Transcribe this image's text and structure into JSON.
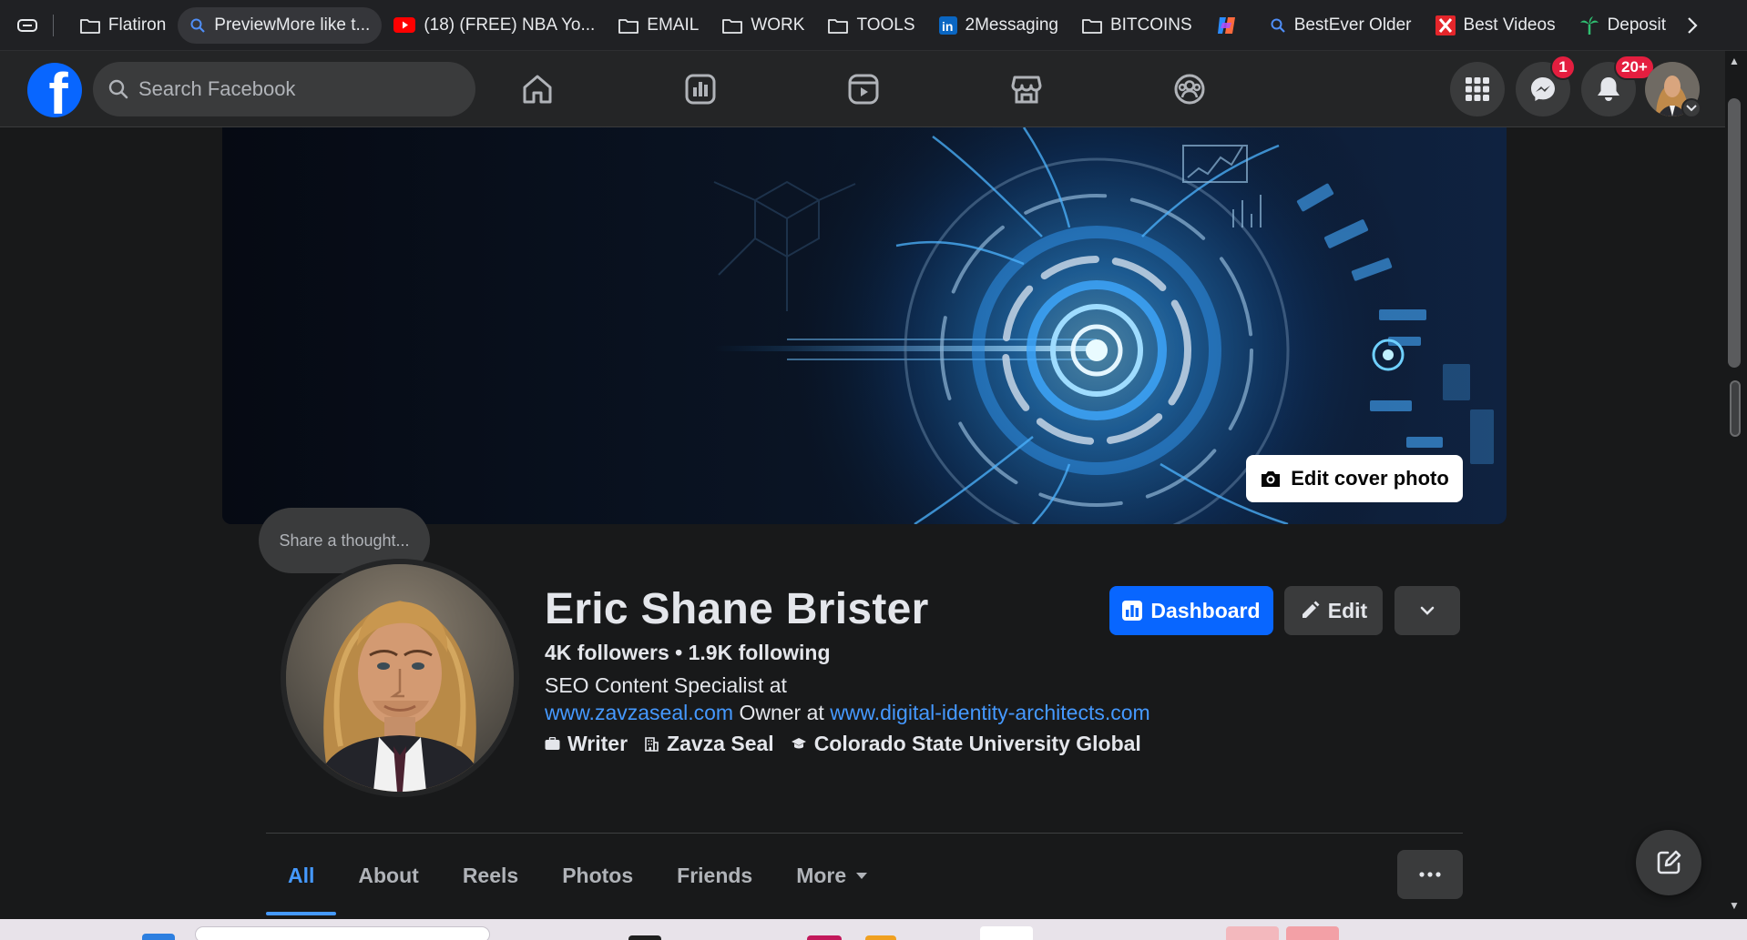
{
  "browser": {
    "bookmarks": [
      {
        "label": "Flatiron",
        "icon": "folder-icon"
      },
      {
        "label": "PreviewMore like t...",
        "icon": "search-icon",
        "active": true
      },
      {
        "label": "(18) (FREE) NBA Yo...",
        "icon": "youtube-icon"
      },
      {
        "label": "EMAIL",
        "icon": "folder-icon"
      },
      {
        "label": "WORK",
        "icon": "folder-icon"
      },
      {
        "label": "TOOLS",
        "icon": "folder-icon"
      },
      {
        "label": "2Messaging",
        "icon": "linkedin-icon"
      },
      {
        "label": "BITCOINS",
        "icon": "folder-icon"
      },
      {
        "label": "",
        "icon": "copilot-icon"
      },
      {
        "label": "BestEver Older",
        "icon": "search-icon"
      },
      {
        "label": "Best Videos",
        "icon": "x-logo-icon"
      },
      {
        "label": "Deposit",
        "icon": "palm-tree-icon"
      }
    ]
  },
  "header": {
    "logo": "f",
    "search_placeholder": "Search Facebook",
    "messenger_badge": "1",
    "notifications_badge": "20+"
  },
  "cover": {
    "edit_label": "Edit cover photo"
  },
  "thought_bubble": "Share a thought...",
  "profile": {
    "name": "Eric Shane Brister",
    "followers": "4K followers",
    "following": "1.9K following",
    "bio_line1": "SEO Content Specialist at",
    "bio_link1": "www.zavzaseal.com",
    "bio_mid": " Owner at ",
    "bio_link2": "www.digital-identity-architects.com",
    "details": [
      {
        "label": "Writer",
        "icon": "briefcase-icon"
      },
      {
        "label": "Zavza Seal",
        "icon": "building-icon"
      },
      {
        "label": "Colorado State University Global",
        "icon": "graduation-cap-icon"
      }
    ]
  },
  "actions": {
    "dashboard": "Dashboard",
    "edit": "Edit"
  },
  "tabs": [
    {
      "label": "All",
      "active": true
    },
    {
      "label": "About"
    },
    {
      "label": "Reels"
    },
    {
      "label": "Photos"
    },
    {
      "label": "Friends"
    },
    {
      "label": "More"
    }
  ],
  "colors": {
    "accent": "#0866ff",
    "link": "#4599ff",
    "badge": "#e41e3f",
    "surface": "#242526",
    "background": "#18191a"
  }
}
